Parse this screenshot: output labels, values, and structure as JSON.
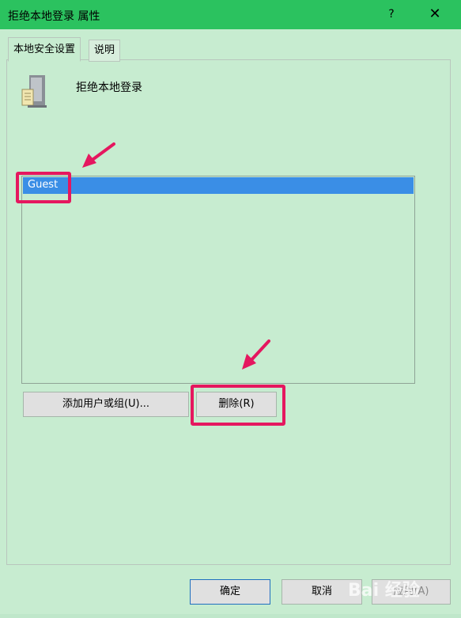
{
  "window": {
    "title": "拒绝本地登录 属性",
    "help_glyph": "?",
    "close_glyph": "✕"
  },
  "tabs": [
    {
      "label": "本地安全设置",
      "active": true
    },
    {
      "label": "说明",
      "active": false
    }
  ],
  "policy": {
    "name": "拒绝本地登录",
    "icon": "server-computer-icon"
  },
  "accounts_list": {
    "items": [
      "Guest"
    ],
    "selected": "Guest"
  },
  "buttons": {
    "add_label": "添加用户或组(U)...",
    "remove_label": "删除(R)",
    "ok_label": "确定",
    "cancel_label": "取消",
    "apply_label": "应用(A)"
  },
  "colors": {
    "titlebar": "#2bc25f",
    "panel_bg": "#c7ecd0",
    "selection": "#3a8ee6",
    "highlight_annotation": "#e5175f"
  },
  "watermark": {
    "text": "Bai 经验"
  }
}
